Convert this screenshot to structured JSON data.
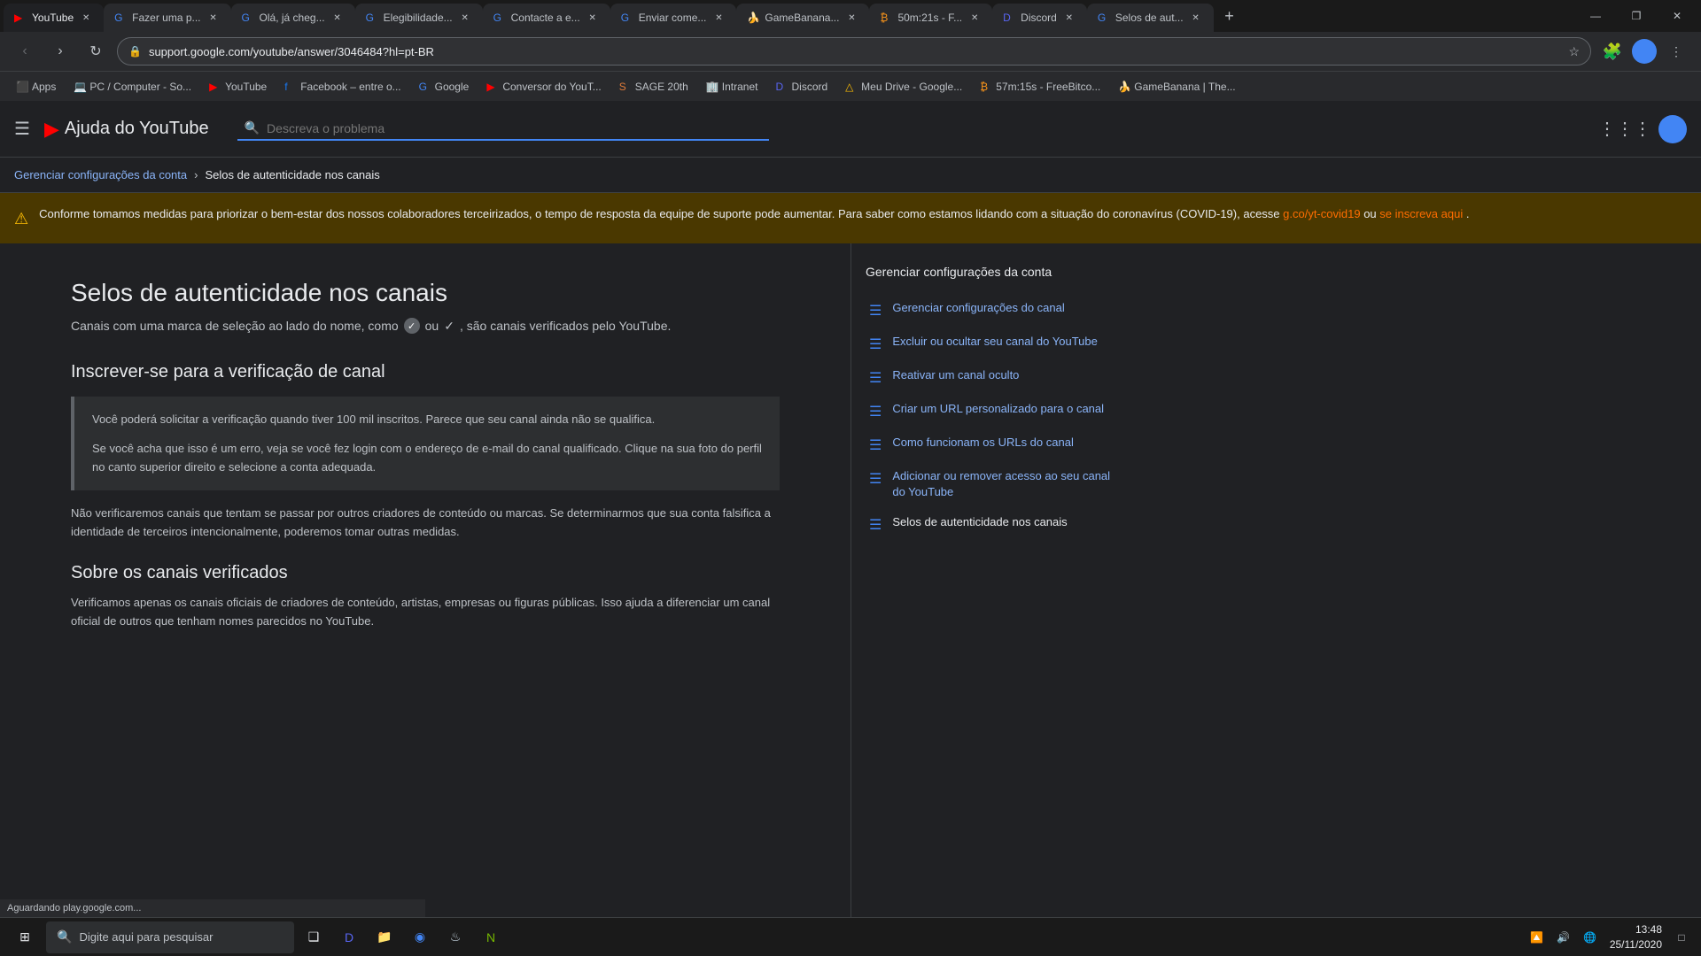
{
  "browser": {
    "tabs": [
      {
        "id": "tab1",
        "label": "YouTube",
        "favicon": "▶",
        "favicon_color": "#ff0000",
        "active": true
      },
      {
        "id": "tab2",
        "label": "Fazer uma p...",
        "favicon": "G",
        "favicon_color": "#4285f4",
        "active": false
      },
      {
        "id": "tab3",
        "label": "Olá, já cheg...",
        "favicon": "G",
        "favicon_color": "#4285f4",
        "active": false
      },
      {
        "id": "tab4",
        "label": "Elegibilidade...",
        "favicon": "G",
        "favicon_color": "#4285f4",
        "active": false
      },
      {
        "id": "tab5",
        "label": "Contacte a e...",
        "favicon": "G",
        "favicon_color": "#4285f4",
        "active": false
      },
      {
        "id": "tab6",
        "label": "Enviar come...",
        "favicon": "G",
        "favicon_color": "#4285f4",
        "active": false
      },
      {
        "id": "tab7",
        "label": "GameBanana...",
        "favicon": "🍌",
        "favicon_color": "#f4c430",
        "active": false
      },
      {
        "id": "tab8",
        "label": "50m:21s - F...",
        "favicon": "₿",
        "favicon_color": "#f7931a",
        "active": false
      },
      {
        "id": "tab9",
        "label": "Discord",
        "favicon": "D",
        "favicon_color": "#5865f2",
        "active": false
      },
      {
        "id": "tab10",
        "label": "Selos de aut...",
        "favicon": "G",
        "favicon_color": "#4285f4",
        "active": false
      }
    ],
    "url": "support.google.com/youtube/answer/3046484?hl=pt-BR",
    "url_display": "support.google.com/youtube/answer/3046484?hl=pt-BR",
    "new_tab_label": "+",
    "window_controls": {
      "minimize": "—",
      "maximize": "❐",
      "close": "✕"
    }
  },
  "bookmarks": [
    {
      "label": "Apps",
      "favicon": "⬛"
    },
    {
      "label": "PC / Computer - So...",
      "favicon": "💻"
    },
    {
      "label": "YouTube",
      "favicon": "▶"
    },
    {
      "label": "Facebook – entre o...",
      "favicon": "f"
    },
    {
      "label": "Google",
      "favicon": "G"
    },
    {
      "label": "Conversor do YouT...",
      "favicon": "▶"
    },
    {
      "label": "SAGE 20th",
      "favicon": "S"
    },
    {
      "label": "Intranet",
      "favicon": "🏢"
    },
    {
      "label": "Discord",
      "favicon": "D"
    },
    {
      "label": "Meu Drive - Google...",
      "favicon": "△"
    },
    {
      "label": "57m:15s - FreeBitco...",
      "favicon": "₿"
    },
    {
      "label": "GameBanana | The...",
      "favicon": "🍌"
    }
  ],
  "header": {
    "menu_icon": "☰",
    "title": "Ajuda do YouTube",
    "search_placeholder": "Descreva o problema",
    "apps_icon": "⋮⋮⋮",
    "logo_icon": "▶"
  },
  "breadcrumb": {
    "parent": "Gerenciar configurações da conta",
    "separator": "›",
    "current": "Selos de autenticidade nos canais"
  },
  "alert": {
    "icon": "⚠",
    "text": "Conforme tomamos medidas para priorizar o bem-estar dos nossos colaboradores terceirizados, o tempo de resposta da equipe de suporte pode aumentar. Para saber como estamos lidando com a situação do coronavírus (COVID-19), acesse ",
    "link1_text": "g.co/yt-covid19",
    "link1_href": "#",
    "middle_text": " ou ",
    "link2_text": "se inscreva aqui",
    "link2_href": "#",
    "end_text": "."
  },
  "article": {
    "title": "Selos de autenticidade nos canais",
    "subtitle_before": "Canais com uma marca de seleção ao lado do nome, como",
    "subtitle_after": "ou   , são canais verificados pelo YouTube.",
    "section1_title": "Inscrever-se para a verificação de canal",
    "infobox1_text1": "Você poderá solicitar a verificação quando tiver 100 mil inscritos. Parece que seu canal ainda não se qualifica.",
    "infobox1_text2": "Se você acha que isso é um erro, veja se você fez login com o endereço de e-mail do canal qualificado. Clique na sua foto do perfil no canto superior direito e selecione a conta adequada.",
    "body_text1": "Não verificaremos canais que tentam se passar por outros criadores de conteúdo ou marcas. Se determinarmos que sua conta falsifica a identidade de terceiros intencionalmente, poderemos tomar outras medidas.",
    "section2_title": "Sobre os canais verificados",
    "body_text2": "Verificamos apenas os canais oficiais de criadores de conteúdo, artistas, empresas ou figuras públicas. Isso ajuda a diferenciar um canal oficial de outros que tenham nomes parecidos no YouTube."
  },
  "sidebar": {
    "title": "Gerenciar configurações da conta",
    "items": [
      {
        "label": "Gerenciar configurações do canal",
        "active": false
      },
      {
        "label": "Excluir ou ocultar seu canal do YouTube",
        "active": false
      },
      {
        "label": "Reativar um canal oculto",
        "active": false
      },
      {
        "label": "Criar um URL personalizado para o canal",
        "active": false
      },
      {
        "label": "Como funcionam os URLs do canal",
        "active": false
      },
      {
        "label": "Adicionar ou remover acesso ao seu canal do YouTube",
        "active": false
      },
      {
        "label": "Selos de autenticidade nos canais",
        "active": true
      }
    ]
  },
  "taskbar": {
    "start_icon": "⊞",
    "search_placeholder": "Digite aqui para pesquisar",
    "search_icon": "🔍",
    "icons": [
      {
        "name": "task-view",
        "icon": "❑"
      },
      {
        "name": "discord",
        "icon": "D"
      },
      {
        "name": "explorer",
        "icon": "📁"
      },
      {
        "name": "chrome",
        "icon": "◉"
      },
      {
        "name": "steam",
        "icon": "♨"
      },
      {
        "name": "nvidia",
        "icon": "N"
      }
    ],
    "sys_icons": [
      "🔼",
      "🔊",
      "🌐"
    ],
    "time": "13:48",
    "date": "25/11/2020",
    "notification": "□"
  },
  "status_bar": {
    "text": "Aguardando play.google.com..."
  }
}
